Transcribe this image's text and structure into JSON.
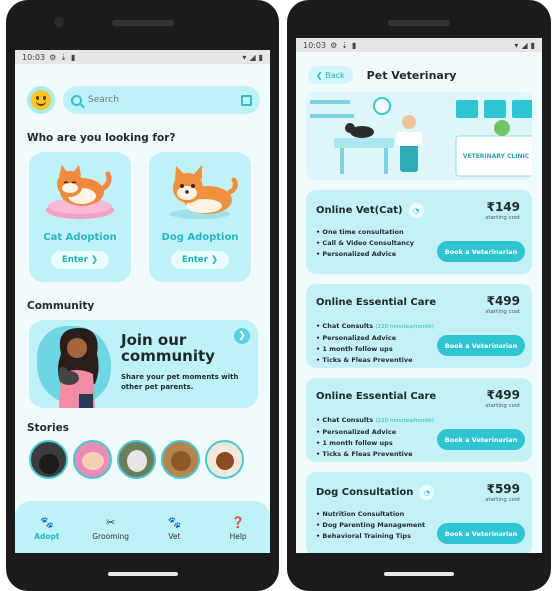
{
  "status": {
    "time": "10:03"
  },
  "home": {
    "search_placeholder": "Search",
    "looking_title": "Who are you looking for?",
    "cards": [
      {
        "label": "Cat Adoption",
        "button": "Enter ❯"
      },
      {
        "label": "Dog Adoption",
        "button": "Enter ❯"
      }
    ],
    "community_title": "Community",
    "community_heading": "Join our community",
    "community_text": "Share your pet moments with other pet parents.",
    "stories_title": "Stories",
    "nav": [
      "Adopt",
      "Grooming",
      "Vet",
      "Help"
    ]
  },
  "vet": {
    "back_label": "❮ Back",
    "title": "Pet Veterinary",
    "hero_sign": "VETERINARY CLINIC",
    "book_label": "Book a Veterinarian",
    "services": [
      {
        "name": "Online Vet(Cat)",
        "price": "₹149",
        "sub": "starting cost",
        "features": [
          "One time consultation",
          "Call & Video Consultancy",
          "Personalized Advice"
        ]
      },
      {
        "name": "Online Essential Care",
        "price": "₹499",
        "sub": "starting cost",
        "chat": "Chat Consults",
        "chat_note": "(220 minutes/month)",
        "features": [
          "Personalized Advice",
          "1 month follow ups",
          "Ticks & Fleas Preventive"
        ]
      },
      {
        "name": "Online Essential Care",
        "price": "₹499",
        "sub": "starting cost",
        "chat": "Chat Consults",
        "chat_note": "(220 minutes/month)",
        "features": [
          "Personalized Advice",
          "1 month follow ups",
          "Ticks & Fleas Preventive"
        ]
      },
      {
        "name": "Dog Consultation",
        "price": "₹599",
        "sub": "starting cost",
        "features": [
          "Nutrition Consultation",
          "Dog Parenting Management",
          "Behavioral Training Tips"
        ]
      }
    ]
  },
  "colors": {
    "accent": "#2fc4d2",
    "card": "#bff2f7",
    "screen_bg": "#f1fbfd"
  }
}
